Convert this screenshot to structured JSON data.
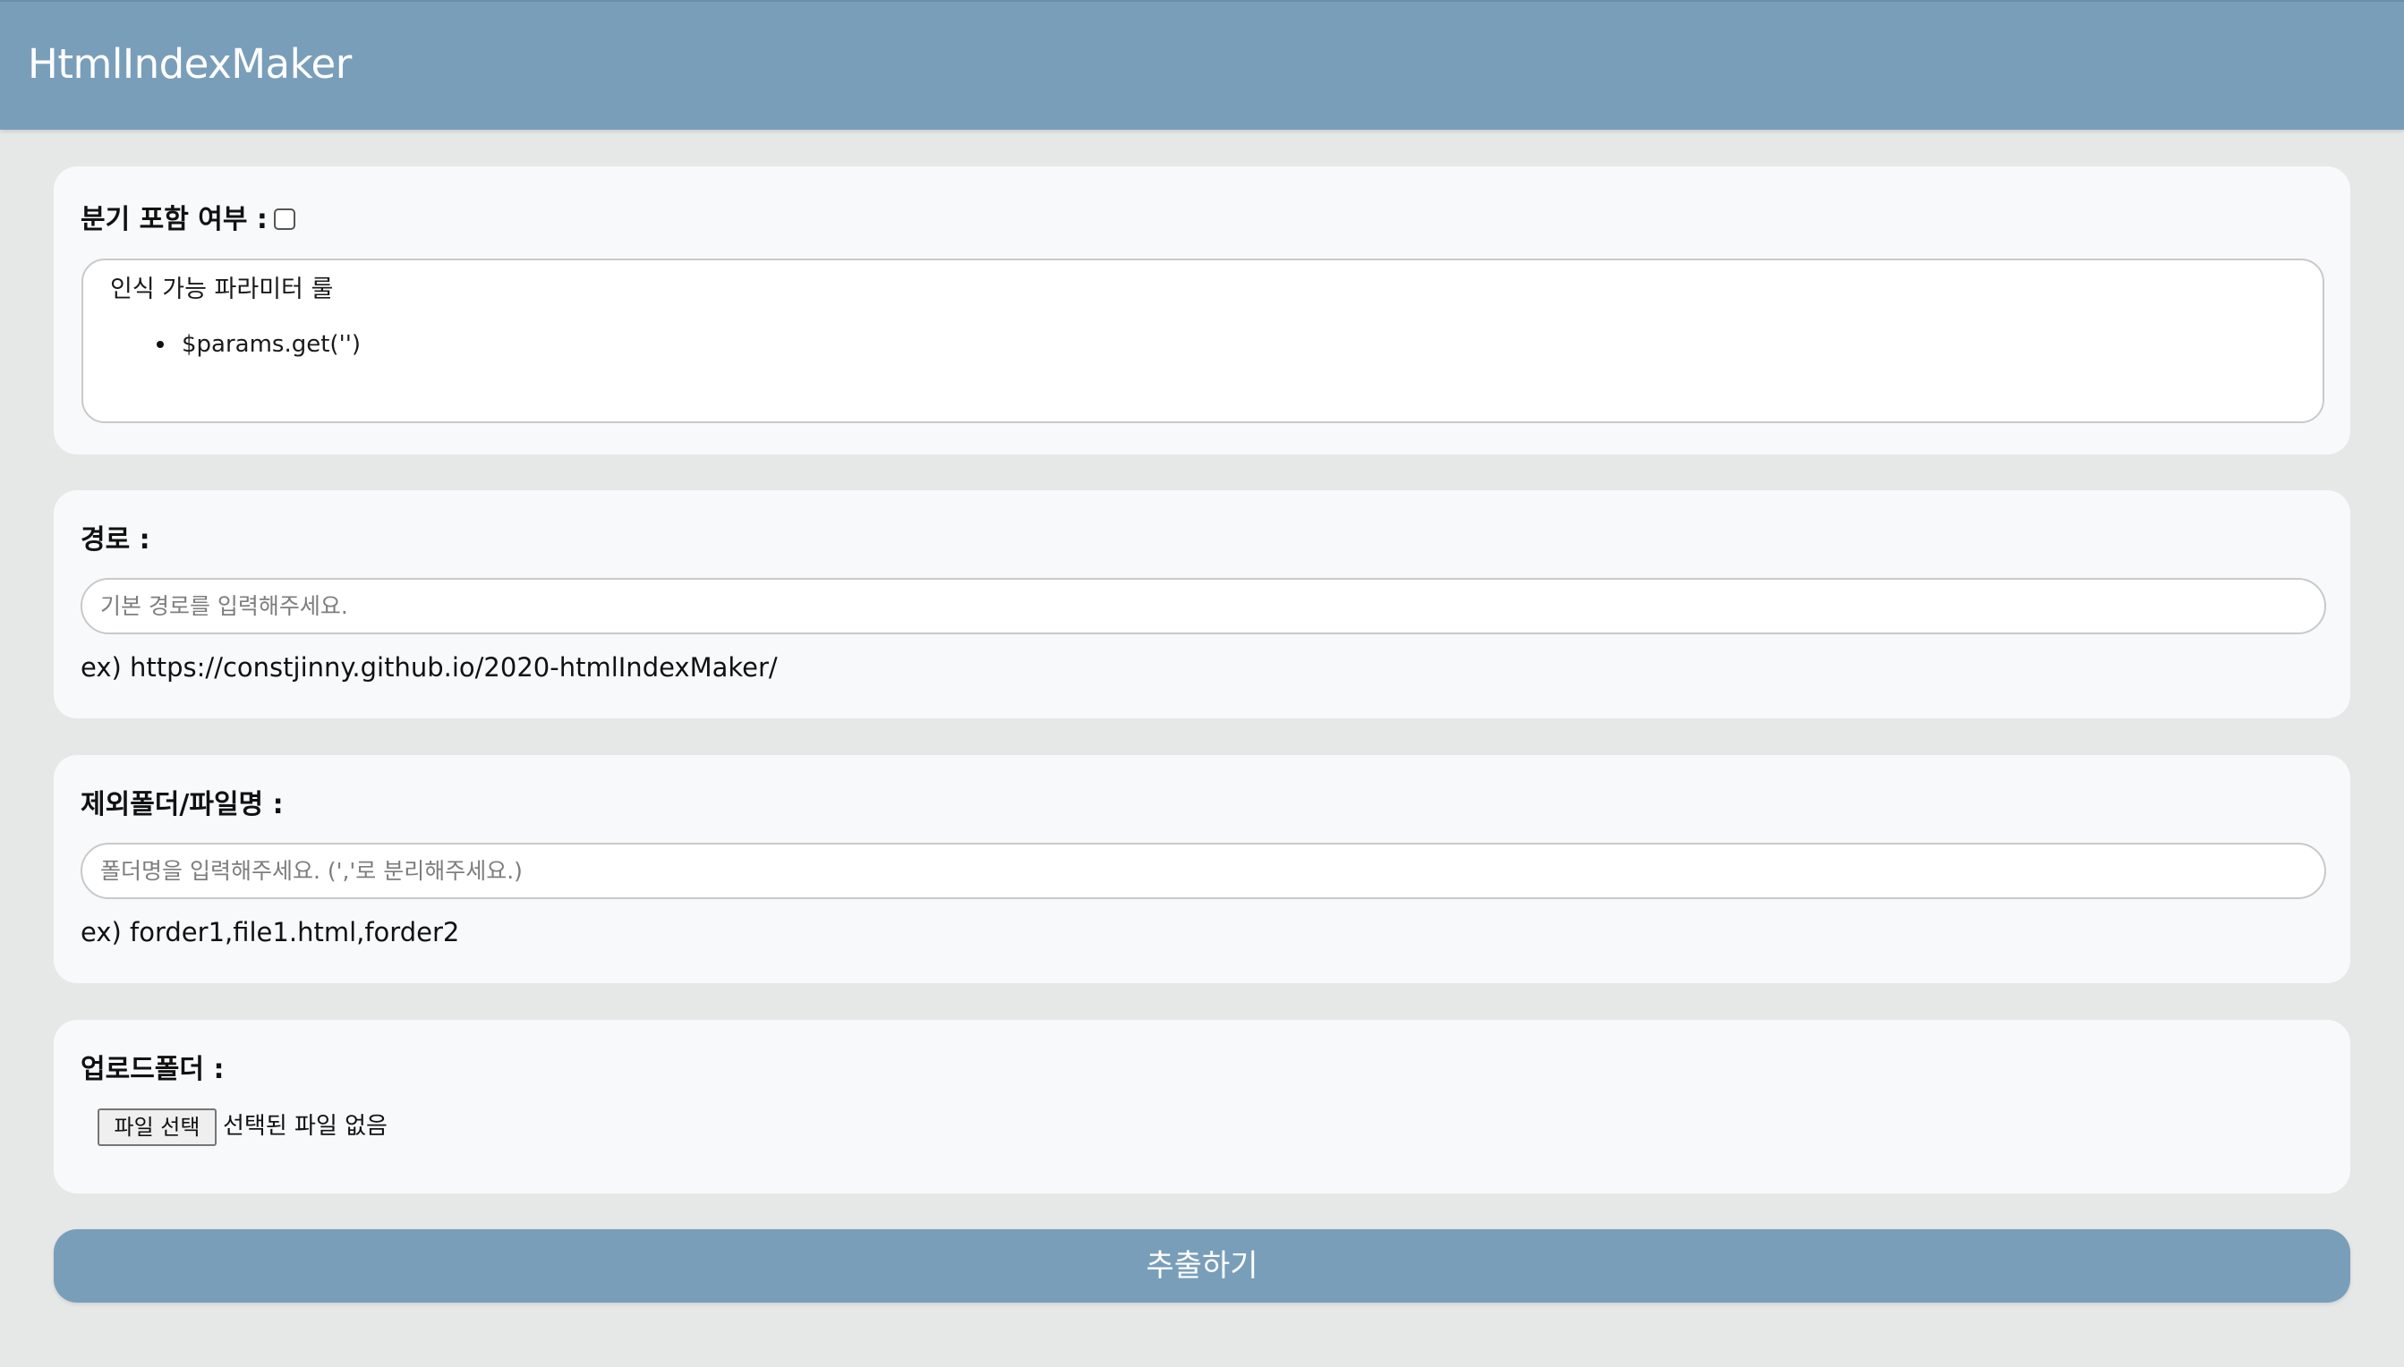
{
  "header": {
    "title": "HtmlIndexMaker",
    "background_color": "#799eba"
  },
  "branch_section": {
    "label": "분기 포함 여부 :",
    "checkbox_checked": false,
    "rules_title": "인식 가능 파라미터 룰",
    "rules_items": [
      "$params.get('')"
    ]
  },
  "path_section": {
    "label": "경로 :",
    "input_value": "",
    "input_placeholder": "기본 경로를 입력해주세요.",
    "example": "ex) https://constjinny.github.io/2020-htmlIndexMaker/"
  },
  "exclude_section": {
    "label": "제외폴더/파일명 :",
    "input_value": "",
    "input_placeholder": "폴더명을 입력해주세요. (','로 분리해주세요.)",
    "example": "ex) forder1,file1.html,forder2"
  },
  "upload_section": {
    "label": "업로드폴더 :",
    "file_button_label": "파일 선택",
    "file_status": "선택된 파일 없음"
  },
  "submit": {
    "label": "추출하기",
    "background_color": "#799eba"
  }
}
